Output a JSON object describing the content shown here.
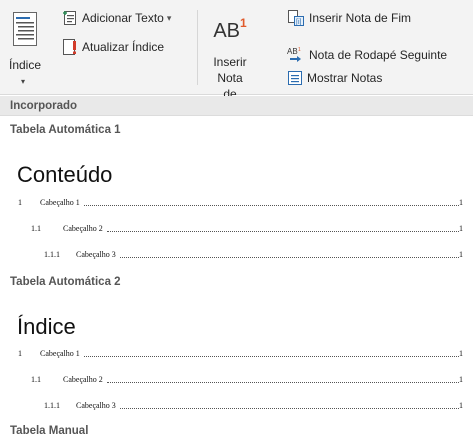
{
  "ribbon": {
    "indice_label": "Índice",
    "adicionar_texto_label": "Adicionar Texto",
    "atualizar_indice_label": "Atualizar Índice",
    "inserir_nota_label_1": "Inserir Nota",
    "inserir_nota_label_2": "de Rodapé",
    "ab_text": "AB",
    "ab_sup": "1",
    "inserir_nota_fim_label": "Inserir Nota de Fim",
    "nota_rodape_seguinte_label": "Nota de Rodapé Seguinte",
    "mostrar_notas_label": "Mostrar Notas",
    "icons": [
      "toc-icon",
      "add-text-icon",
      "update-table-icon",
      "footnote-icon",
      "endnote-icon",
      "next-footnote-icon",
      "show-notes-icon"
    ]
  },
  "gallery": {
    "section_header": "Incorporado",
    "items": [
      {
        "title": "Tabela Automática 1",
        "heading": "Conteúdo",
        "lines": [
          {
            "num": "1",
            "text": "Cabeçalho 1",
            "page": "1"
          },
          {
            "num": "1.1",
            "text": "Cabeçalho 2",
            "page": "1"
          },
          {
            "num": "1.1.1",
            "text": "Cabeçalho 3",
            "page": "1"
          }
        ]
      },
      {
        "title": "Tabela Automática 2",
        "heading": "Índice",
        "lines": [
          {
            "num": "1",
            "text": "Cabeçalho 1",
            "page": "1"
          },
          {
            "num": "1.1",
            "text": "Cabeçalho 2",
            "page": "1"
          },
          {
            "num": "1.1.1",
            "text": "Cabeçalho 3",
            "page": "1"
          }
        ]
      },
      {
        "title": "Tabela Manual"
      }
    ]
  },
  "colors": {
    "ribbon_bg": "#f3f3f3",
    "accent_blue": "#2b6cb0",
    "accent_red": "#e05a2b"
  }
}
